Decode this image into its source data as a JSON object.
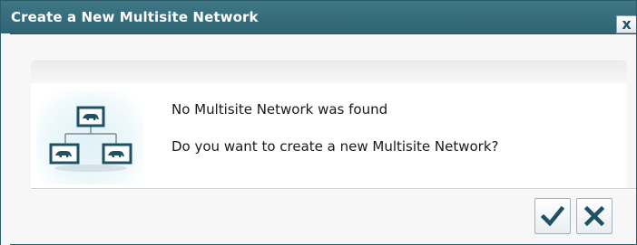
{
  "window": {
    "title": "Create a New Multisite Network",
    "close_glyph": "x"
  },
  "message": {
    "line1": "No Multisite Network was found",
    "line2": "Do you want to create a new Multisite Network?",
    "icon": "multisite-network-icon"
  },
  "buttons": {
    "confirm_icon": "checkmark-icon",
    "cancel_icon": "close-icon"
  },
  "colors": {
    "titlebar": "#2e6473",
    "icon_accent": "#1d5163",
    "background": "#f7f7f7"
  }
}
